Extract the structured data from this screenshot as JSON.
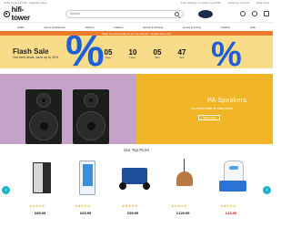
{
  "topbar": {
    "left": "Order before 15:00 – shipped today",
    "links": [
      "Free delivery on orders over £50",
      "Customer Service",
      "Shop Now"
    ]
  },
  "header": {
    "logo": "hifi-tower",
    "search_placeholder": "Search"
  },
  "nav": {
    "items": [
      "Audio",
      "Home Appliances",
      "Kitchen",
      "Garden",
      "Sports & Fitness",
      "Home & Living",
      "Outdoor",
      "Sale"
    ]
  },
  "promo": "Shop the best deals on our top brands – limited time only",
  "flash_sale": {
    "title": "Flash Sale",
    "subtitle": "Our best deals, save up to 30%",
    "percent_symbol": "%",
    "countdown": [
      {
        "value": "05",
        "label": "Days"
      },
      {
        "value": "10",
        "label": "Hours"
      },
      {
        "value": "05",
        "label": "Mins"
      },
      {
        "value": "47",
        "label": "Secs"
      }
    ]
  },
  "hero": {
    "title": "PA Speakers",
    "subtitle": "Loud and clear at every event",
    "button": "Shop now"
  },
  "top_products": {
    "title": "Our Top Picks",
    "prev": "‹",
    "next": "›",
    "items": [
      {
        "name": "Mini fridge",
        "stars": "★★★★★",
        "price": "£89.99",
        "sale": false
      },
      {
        "name": "Water dispenser",
        "stars": "★★★★★",
        "price": "£69.99",
        "sale": false
      },
      {
        "name": "Folding trolley",
        "stars": "★★★★★",
        "price": "£59.99",
        "sale": false
      },
      {
        "name": "Patio heater lamp",
        "stars": "★★★★★",
        "price": "£129.99",
        "sale": false
      },
      {
        "name": "Air purifier",
        "stars": "★★★★★",
        "price": "£49.99",
        "sale": true
      }
    ]
  },
  "colors": {
    "accent": "#1cb5c8",
    "promo": "#ef7a2a",
    "flash_bg": "#f9dc8a",
    "percent": "#1c5fd6",
    "hero_left": "#c5a3c9",
    "hero_right": "#f1b528"
  }
}
